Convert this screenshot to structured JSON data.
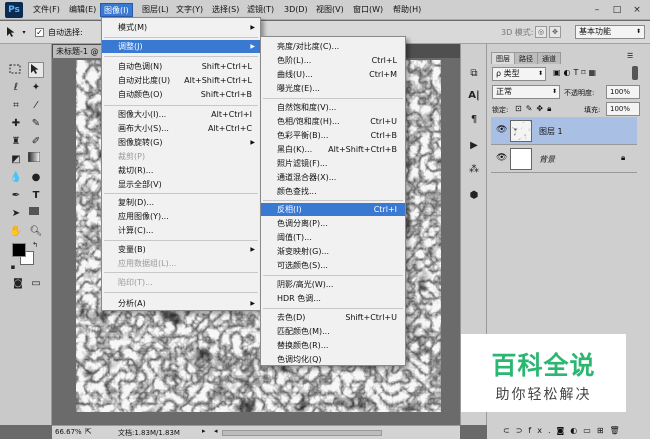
{
  "app": {
    "logo": "Ps"
  },
  "menubar": {
    "items": [
      "文件(F)",
      "编辑(E)",
      "图像(I)",
      "图层(L)",
      "文字(Y)",
      "选择(S)",
      "滤镜(T)",
      "3D(D)",
      "视图(V)",
      "窗口(W)",
      "帮助(H)"
    ],
    "active": "图像(I)",
    "min": "–",
    "max": "□",
    "close": "×"
  },
  "options": {
    "autoselect": "自动选择:",
    "mode3d": "3D 模式:",
    "workspace": "基本功能"
  },
  "document": {
    "tab": "未标题-1 @"
  },
  "status": {
    "zoom": "66.67%",
    "doc": "文档:1.83M/1.83M"
  },
  "image_menu": {
    "items": [
      {
        "label": "模式(M)",
        "shortcut": "",
        "submenu": true,
        "disabled": false
      },
      {
        "label": "调整(J)",
        "shortcut": "",
        "submenu": true,
        "disabled": false,
        "highlight": true
      },
      {
        "label": "自动色调(N)",
        "shortcut": "Shift+Ctrl+L"
      },
      {
        "label": "自动对比度(U)",
        "shortcut": "Alt+Shift+Ctrl+L"
      },
      {
        "label": "自动颜色(O)",
        "shortcut": "Shift+Ctrl+B"
      },
      {
        "label": "图像大小(I)...",
        "shortcut": "Alt+Ctrl+I"
      },
      {
        "label": "画布大小(S)...",
        "shortcut": "Alt+Ctrl+C"
      },
      {
        "label": "图像旋转(G)",
        "shortcut": "",
        "submenu": true
      },
      {
        "label": "裁剪(P)",
        "shortcut": "",
        "disabled": true
      },
      {
        "label": "裁切(R)...",
        "shortcut": ""
      },
      {
        "label": "显示全部(V)",
        "shortcut": ""
      },
      {
        "label": "复制(D)...",
        "shortcut": ""
      },
      {
        "label": "应用图像(Y)...",
        "shortcut": ""
      },
      {
        "label": "计算(C)...",
        "shortcut": ""
      },
      {
        "label": "变量(B)",
        "shortcut": "",
        "submenu": true
      },
      {
        "label": "应用数据组(L)...",
        "shortcut": "",
        "disabled": true
      },
      {
        "label": "陷印(T)...",
        "shortcut": "",
        "disabled": true
      },
      {
        "label": "分析(A)",
        "shortcut": "",
        "submenu": true
      }
    ]
  },
  "adjust_menu": {
    "items": [
      {
        "label": "亮度/对比度(C)...",
        "shortcut": ""
      },
      {
        "label": "色阶(L)...",
        "shortcut": "Ctrl+L"
      },
      {
        "label": "曲线(U)...",
        "shortcut": "Ctrl+M"
      },
      {
        "label": "曝光度(E)...",
        "shortcut": ""
      },
      {
        "label": "自然饱和度(V)...",
        "shortcut": ""
      },
      {
        "label": "色相/饱和度(H)...",
        "shortcut": "Ctrl+U"
      },
      {
        "label": "色彩平衡(B)...",
        "shortcut": "Ctrl+B"
      },
      {
        "label": "黑白(K)...",
        "shortcut": "Alt+Shift+Ctrl+B"
      },
      {
        "label": "照片滤镜(F)...",
        "shortcut": ""
      },
      {
        "label": "通道混合器(X)...",
        "shortcut": ""
      },
      {
        "label": "颜色查找...",
        "shortcut": ""
      },
      {
        "label": "反相(I)",
        "shortcut": "Ctrl+I",
        "highlight": true
      },
      {
        "label": "色调分离(P)...",
        "shortcut": ""
      },
      {
        "label": "阈值(T)...",
        "shortcut": ""
      },
      {
        "label": "渐变映射(G)...",
        "shortcut": ""
      },
      {
        "label": "可选颜色(S)...",
        "shortcut": ""
      },
      {
        "label": "阴影/高光(W)...",
        "shortcut": ""
      },
      {
        "label": "HDR 色调...",
        "shortcut": ""
      },
      {
        "label": "去色(D)",
        "shortcut": "Shift+Ctrl+U"
      },
      {
        "label": "匹配颜色(M)...",
        "shortcut": ""
      },
      {
        "label": "替换颜色(R)...",
        "shortcut": ""
      },
      {
        "label": "色调均化(Q)",
        "shortcut": ""
      }
    ]
  },
  "layers_panel": {
    "tabs": [
      "图层",
      "路径",
      "通道"
    ],
    "filter": "ρ 类型",
    "blend": "正常",
    "opacity_label": "不透明度:",
    "opacity": "100%",
    "lock_label": "锁定:",
    "fill_label": "填充:",
    "fill": "100%",
    "layers": [
      {
        "name": "图层 1",
        "selected": true
      },
      {
        "name": "背景",
        "italic": true,
        "locked": true
      }
    ],
    "bottom_icons": [
      "fx."
    ]
  },
  "watermark": {
    "title": "百科全说",
    "subtitle": "助你轻松解决"
  }
}
